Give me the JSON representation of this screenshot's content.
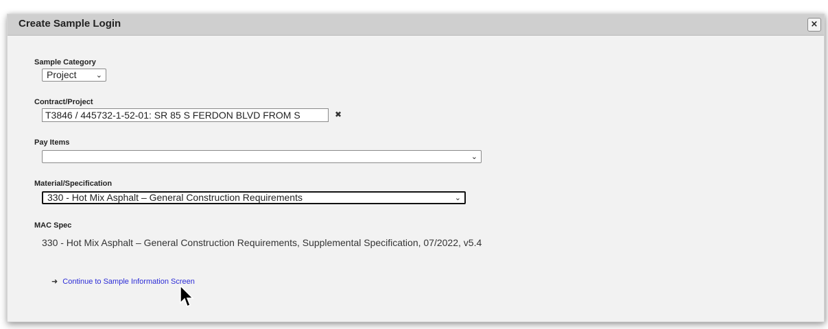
{
  "dialog": {
    "title": "Create Sample Login",
    "close_label": "×"
  },
  "sample_category": {
    "label": "Sample Category",
    "value": "Project"
  },
  "contract_project": {
    "label": "Contract/Project",
    "value": "T3846 / 445732-1-52-01: SR 85 S FERDON BLVD FROM S",
    "clear_icon": "✖"
  },
  "pay_items": {
    "label": "Pay Items",
    "value": ""
  },
  "material_spec": {
    "label": "Material/Specification",
    "value": "330 - Hot Mix Asphalt – General Construction Requirements"
  },
  "mac_spec": {
    "label": "MAC Spec",
    "value": "330 - Hot Mix Asphalt – General Construction Requirements, Supplemental Specification, 07/2022, v5.4"
  },
  "continue_link": {
    "arrow": "➜",
    "label": "Continue to Sample Information Screen"
  },
  "icons": {
    "dropdown": "chevron-down-icon",
    "close": "close-icon",
    "cursor": "mouse-pointer-icon"
  }
}
